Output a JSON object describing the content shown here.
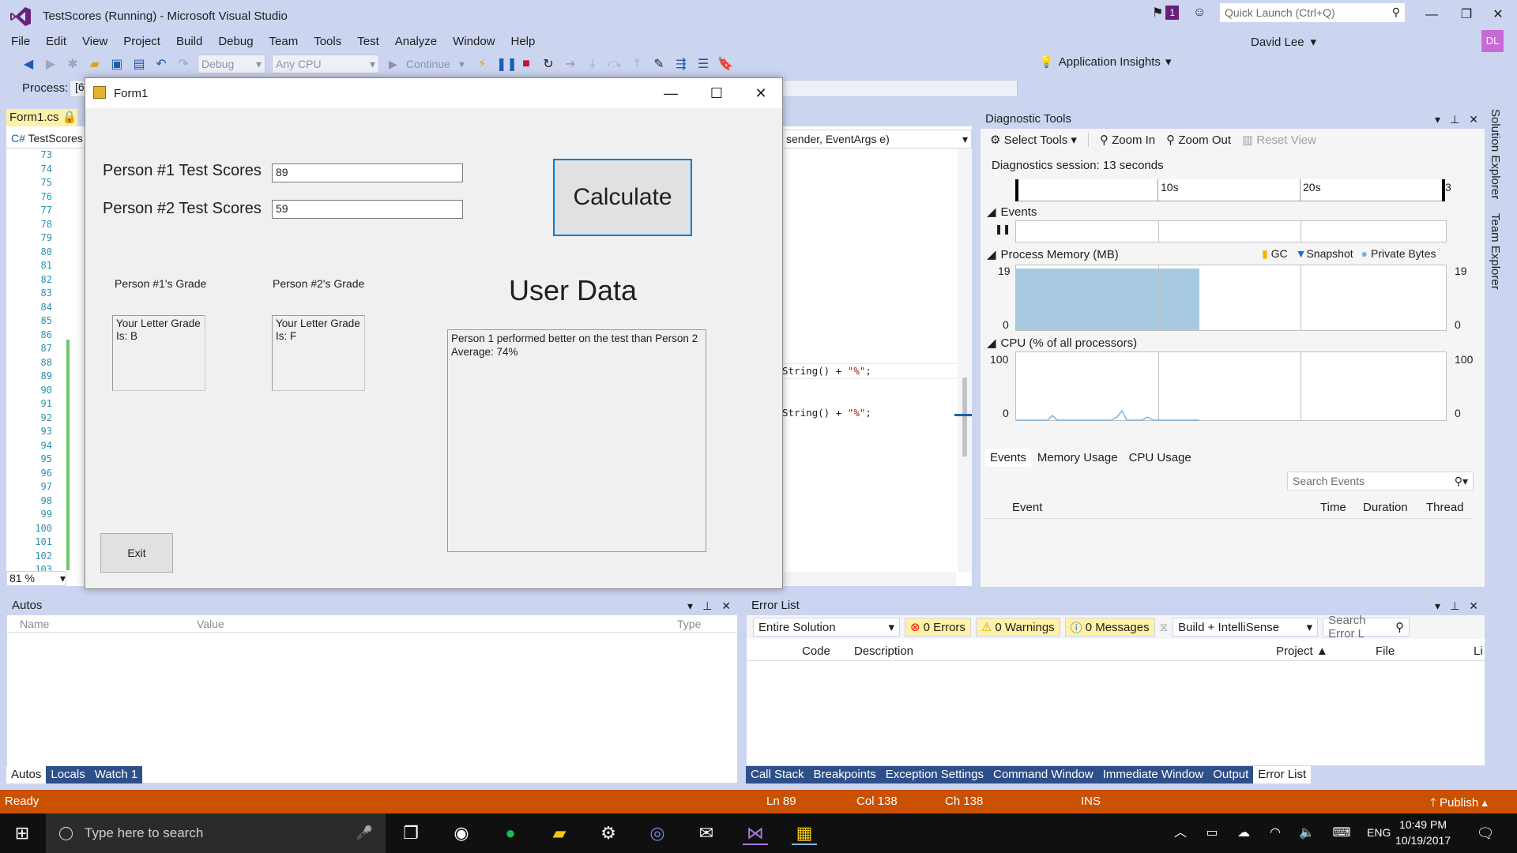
{
  "window": {
    "title": "TestScores (Running) - Microsoft Visual Studio",
    "notification_count": "1",
    "quick_launch_placeholder": "Quick Launch (Ctrl+Q)"
  },
  "menu": [
    "File",
    "Edit",
    "View",
    "Project",
    "Build",
    "Debug",
    "Team",
    "Tools",
    "Test",
    "Analyze",
    "Window",
    "Help"
  ],
  "user": {
    "name": "David Lee",
    "initials": "DL"
  },
  "toolbar": {
    "config": "Debug",
    "platform": "Any CPU",
    "continue": "Continue",
    "insights": "Application Insights"
  },
  "process": {
    "label": "Process:",
    "value": "[6"
  },
  "editor": {
    "tab": "Form1.cs",
    "project": "TestScores",
    "method": "sender, EventArgs e)",
    "line_numbers": [
      "73",
      "74",
      "75",
      "76",
      "77",
      "78",
      "79",
      "80",
      "81",
      "82",
      "83",
      "84",
      "85",
      "86",
      "87",
      "88",
      "89",
      "90",
      "91",
      "92",
      "93",
      "94",
      "95",
      "96",
      "97",
      "98",
      "99",
      "100",
      "101",
      "102",
      "103"
    ],
    "code_line_1": {
      "prefix": "String() + ",
      "str": "\"%\"",
      "suffix": ";"
    },
    "code_line_2": {
      "prefix": "String() + ",
      "str": "\"%\"",
      "suffix": ";"
    },
    "zoom": "81 %"
  },
  "form1": {
    "title": "Form1",
    "p1_label": "Person #1 Test Scores",
    "p1_value": "89",
    "p2_label": "Person #2 Test Scores",
    "p2_value": "59",
    "calculate": "Calculate",
    "p1_grade_label": "Person #1's Grade",
    "p2_grade_label": "Person #2's Grade",
    "p1_grade_box": "Your Letter Grade Is: B",
    "p2_grade_box": "Your Letter Grade Is: F",
    "user_data_title": "User Data",
    "output_line1": "Person 1 performed better on the test than Person 2",
    "output_line2": "Average: 74%",
    "exit": "Exit"
  },
  "diagnostics": {
    "title": "Diagnostic Tools",
    "select_tools": "Select Tools",
    "zoom_in": "Zoom In",
    "zoom_out": "Zoom Out",
    "reset_view": "Reset View",
    "session": "Diagnostics session: 13 seconds",
    "ruler_labels": [
      "10s",
      "20s",
      "3"
    ],
    "events": "Events",
    "memory": "Process Memory (MB)",
    "legend": [
      "GC",
      "Snapshot",
      "Private Bytes"
    ],
    "mem_max": "19",
    "mem_min": "0",
    "memory_level": 0.95,
    "cpu": "CPU (% of all processors)",
    "cpu_max": "100",
    "cpu_min": "0",
    "tabs": [
      "Events",
      "Memory Usage",
      "CPU Usage"
    ],
    "search": "Search Events",
    "columns": [
      "Event",
      "Time",
      "Duration",
      "Thread"
    ]
  },
  "side_tabs": [
    "Solution Explorer",
    "Team Explorer"
  ],
  "autos": {
    "title": "Autos",
    "columns": [
      "Name",
      "Value",
      "Type"
    ],
    "tabs": [
      "Autos",
      "Locals",
      "Watch 1"
    ]
  },
  "errors": {
    "title": "Error List",
    "scope": "Entire Solution",
    "errors": "0 Errors",
    "warnings": "0 Warnings",
    "messages": "0 Messages",
    "build": "Build + IntelliSense",
    "search": "Search Error L",
    "columns": [
      "Code",
      "Description",
      "Project",
      "File",
      "Li"
    ],
    "bottom_tabs": [
      "Call Stack",
      "Breakpoints",
      "Exception Settings",
      "Command Window",
      "Immediate Window",
      "Output",
      "Error List"
    ]
  },
  "status": {
    "ready": "Ready",
    "ln": "Ln 89",
    "col": "Col 138",
    "ch": "Ch 138",
    "ins": "INS",
    "publish": "Publish"
  },
  "taskbar": {
    "search": "Type here to search",
    "lang": "ENG",
    "time": "10:49 PM",
    "date": "10/19/2017"
  },
  "colors": {
    "accent": "#68217a",
    "status": "#ca5100",
    "chrome": "#ccd5f0",
    "memory_fill": "#a7c9e0"
  }
}
